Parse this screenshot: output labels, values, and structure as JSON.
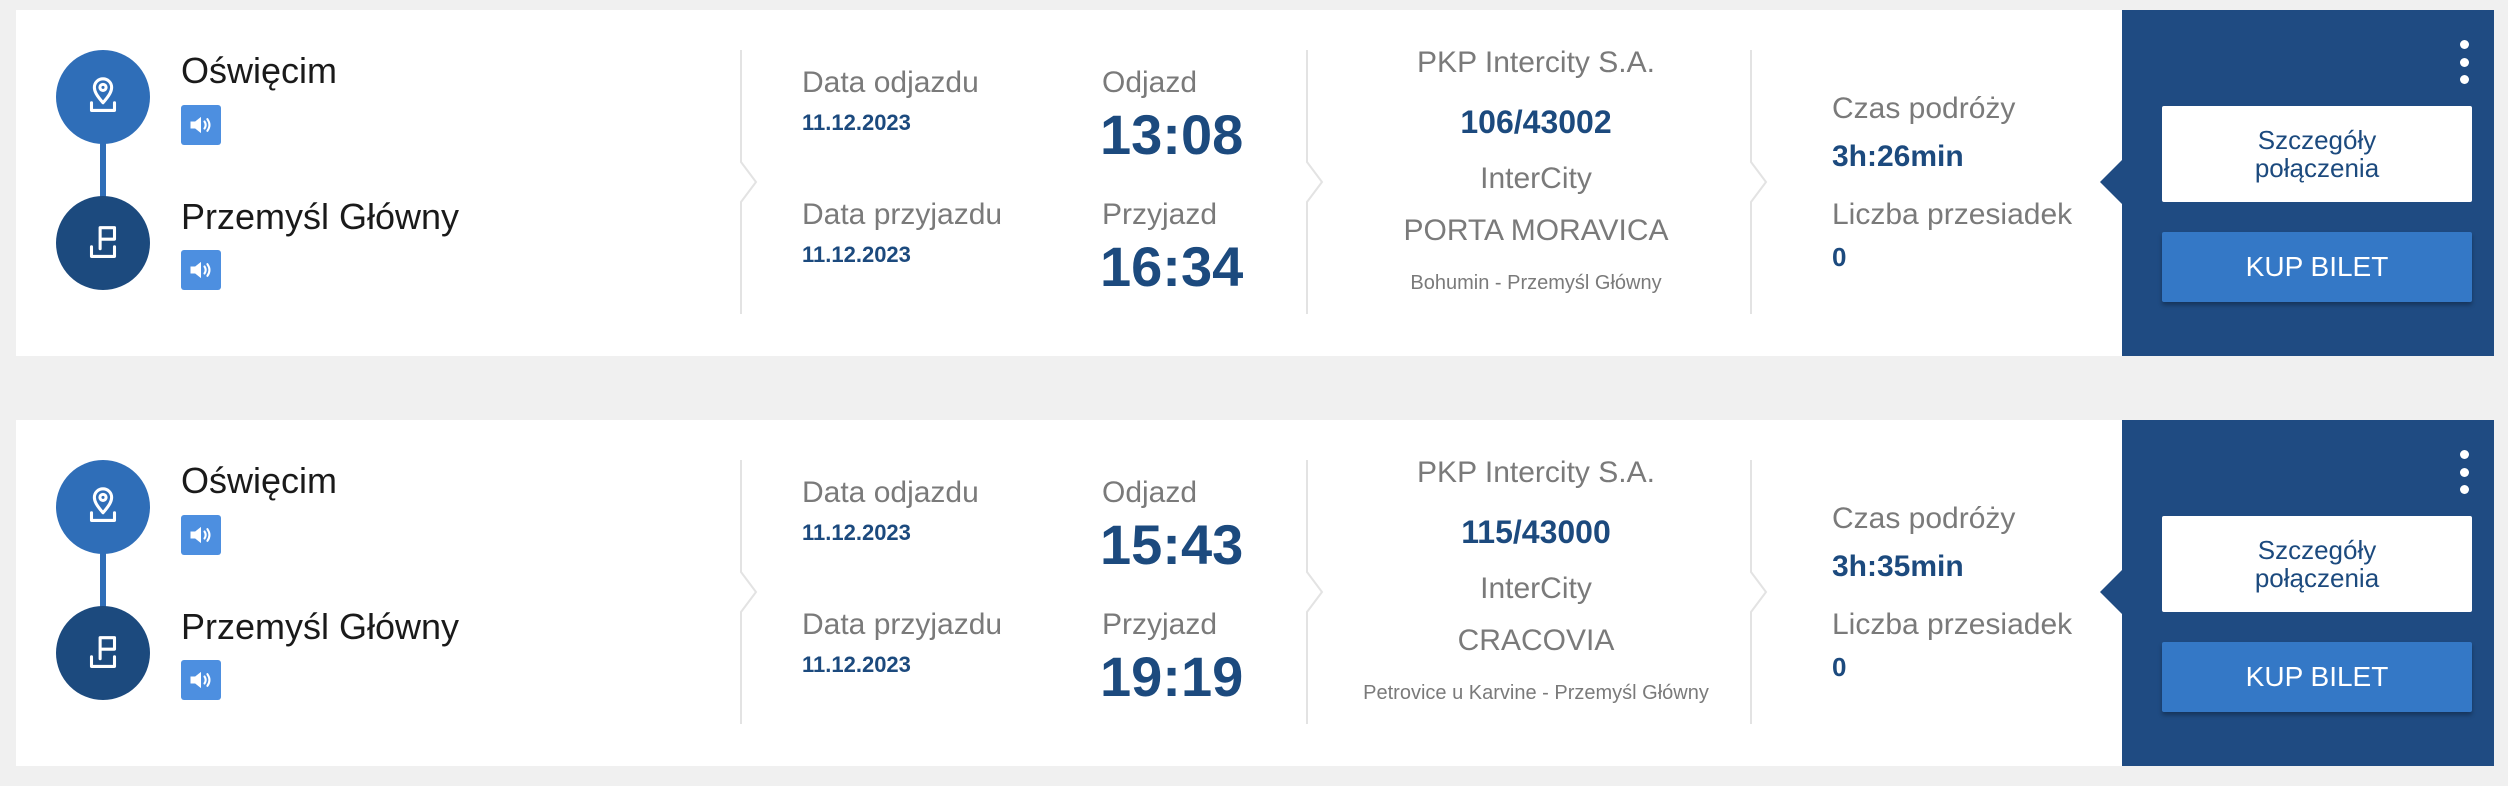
{
  "labels": {
    "departure_date": "Data odjazdu",
    "arrival_date": "Data przyjazdu",
    "departure": "Odjazd",
    "arrival": "Przyjazd",
    "travel_time": "Czas podróży",
    "transfers": "Liczba przesiadek",
    "details_button_line1": "Szczegóły",
    "details_button_line2": "połączenia",
    "buy_button": "KUP BILET"
  },
  "icons": {
    "origin": "location-pin-icon",
    "destination": "flag-icon",
    "audio": "speaker-icon",
    "menu": "more-vertical-icon"
  },
  "colors": {
    "brand_dark": "#1f4b82",
    "brand": "#2f6eb8",
    "accent_button": "#3478c6",
    "speaker": "#4d8fe0"
  },
  "connections": [
    {
      "from": "Oświęcim",
      "to": "Przemyśl Główny",
      "departure_date": "11.12.2023",
      "arrival_date": "11.12.2023",
      "departure_time": "13:08",
      "arrival_time": "16:34",
      "carrier": "PKP Intercity S.A.",
      "train_number": "106/43002",
      "category": "InterCity",
      "train_name": "PORTA MORAVICA",
      "route": "Bohumin - Przemyśl Główny",
      "travel_time": "3h:26min",
      "transfers": "0"
    },
    {
      "from": "Oświęcim",
      "to": "Przemyśl Główny",
      "departure_date": "11.12.2023",
      "arrival_date": "11.12.2023",
      "departure_time": "15:43",
      "arrival_time": "19:19",
      "carrier": "PKP Intercity S.A.",
      "train_number": "115/43000",
      "category": "InterCity",
      "train_name": "CRACOVIA",
      "route": "Petrovice u Karvine - Przemyśl Główny",
      "travel_time": "3h:35min",
      "transfers": "0"
    }
  ]
}
